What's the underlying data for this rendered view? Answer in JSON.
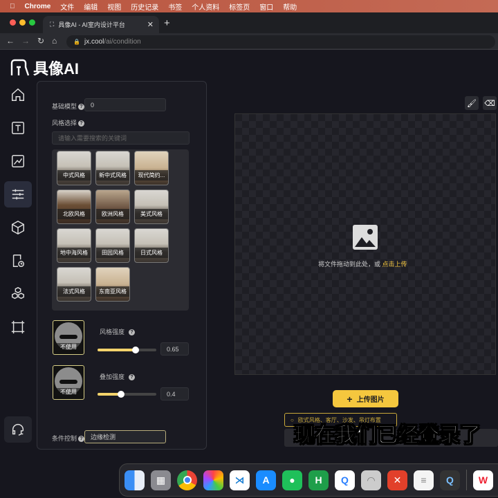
{
  "menubar": {
    "app": "Chrome",
    "items": [
      "文件",
      "编辑",
      "视图",
      "历史记录",
      "书签",
      "个人资料",
      "标签页",
      "窗口",
      "帮助"
    ]
  },
  "browser": {
    "tab_title": "具像AI - AI室内设计平台",
    "url_host": "jx.cool",
    "url_path": "/ai/condition"
  },
  "logo": {
    "text": "具像AI"
  },
  "sidebar": {
    "items": [
      "home",
      "text",
      "sketch",
      "adjust",
      "cube",
      "history",
      "assets",
      "frame"
    ],
    "active": "adjust",
    "support": "headset"
  },
  "panel": {
    "base_model_label": "基础模型",
    "base_model_value": "0",
    "style_label": "风格选择",
    "style_search_placeholder": "请输入需要搜索的关键词",
    "styles": [
      "中式风格",
      "新中式风格",
      "现代简约...",
      "北欧风格",
      "欧洲风格",
      "美式风格",
      "地中海风格",
      "田园风格",
      "日式风格",
      "法式风格",
      "东南亚风格"
    ],
    "style_strength": {
      "label": "风格强度",
      "value": "0.65",
      "fraction": 0.65,
      "ref_label": "不使用"
    },
    "overlay_strength": {
      "label": "叠加强度",
      "value": "0.4",
      "fraction": 0.4,
      "ref_label": "不使用"
    },
    "condition_label": "条件控制",
    "condition_value": "边缘检测"
  },
  "canvas": {
    "drop_text": "将文件拖动到此处，或",
    "drop_link": "点击上传",
    "tools": [
      "brush",
      "eraser"
    ]
  },
  "upload_button": "上传图片",
  "strip_text": "欧式风格、客厅、沙发、吊灯布置",
  "subtitle": "现在我们已经登录了",
  "dock": [
    "Finder",
    "Launchpad",
    "Chrome",
    "Photos",
    "VS Code",
    "App Store",
    "WeChat",
    "H",
    "Chat",
    "Messages",
    "XMind",
    "Reminders",
    "QuickTime",
    "WPS"
  ],
  "colors": {
    "accent": "#f5c73e",
    "background": "#16161e"
  }
}
